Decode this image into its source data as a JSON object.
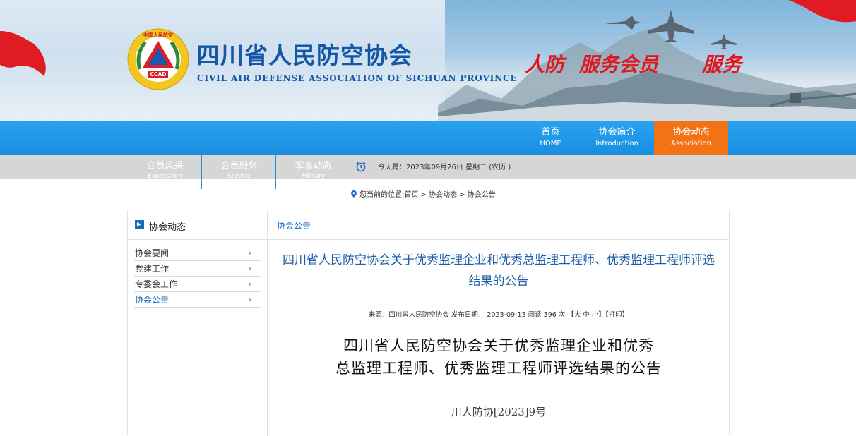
{
  "header": {
    "site_title": "四川省人民防空协会",
    "site_subtitle": "CIVIL AIR DEFENSE ASSOCIATION OF SICHUAN PROVINCE",
    "logo_ring_text": "中国人民防空",
    "logo_text": "CCAD",
    "slogan_1": "人防",
    "slogan_2": "服务会员",
    "slogan_3": "服务"
  },
  "nav": {
    "items": [
      {
        "cn": "首页",
        "en": "HOME"
      },
      {
        "cn": "协会简介",
        "en": "Introduction"
      },
      {
        "cn": "协会动态",
        "en": "Association"
      }
    ],
    "active_index": 2
  },
  "subnav": {
    "items": [
      {
        "cn": "会员风采",
        "en": "Expression"
      },
      {
        "cn": "会员服务",
        "en": "Service"
      },
      {
        "cn": "军事动态",
        "en": "Military"
      }
    ],
    "date_text": "今天是：2023年09月26日 星期二 (农历 )"
  },
  "breadcrumb": "您当前的位置:首页 > 协会动态 > 协会公告",
  "sidebar": {
    "title": "协会动态",
    "items": [
      "协会要闻",
      "党建工作",
      "专委会工作",
      "协会公告"
    ],
    "active_index": 3,
    "chevron": "›"
  },
  "content": {
    "section_title": "协会公告",
    "article_title": "四川省人民防空协会关于优秀监理企业和优秀总监理工程师、优秀监理工程师评选结果的公告",
    "meta": "来源：四川省人民防空协会 发布日期： 2023-09-13 阅读 396 次 【大 中 小】【打印】",
    "doc_title_line1": "四川省人民防空协会关于优秀监理企业和优秀",
    "doc_title_line2": "总监理工程师、优秀监理工程师评选结果的公告",
    "doc_number": "川人防协[2023]9号"
  },
  "colors": {
    "nav_blue": "#1a8de0",
    "nav_active": "#f27216",
    "title_blue": "#1357a6",
    "link_blue": "#1a6cc0",
    "slogan_red": "#e0151e"
  }
}
